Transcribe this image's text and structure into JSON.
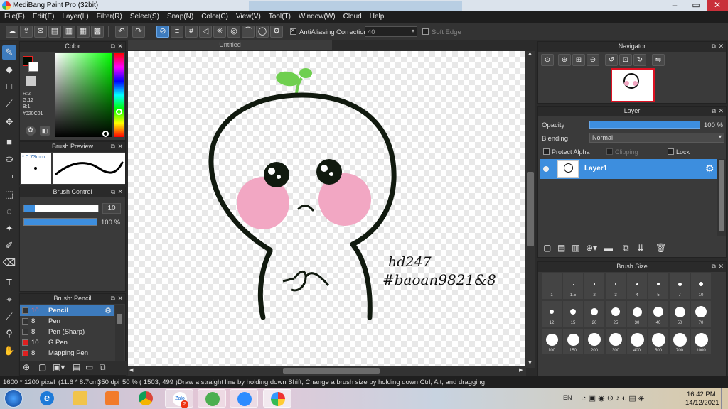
{
  "window": {
    "title": "MediBang Paint Pro (32bit)"
  },
  "menu": [
    "File(F)",
    "Edit(E)",
    "Layer(L)",
    "Filter(R)",
    "Select(S)",
    "Snap(N)",
    "Color(C)",
    "View(V)",
    "Tool(T)",
    "Window(W)",
    "Cloud",
    "Help"
  ],
  "toolbar": {
    "antialiasing_label": "AntiAliasing",
    "correction_label": "Correction",
    "correction_value": "40",
    "soft_edge_label": "Soft Edge",
    "icons": [
      "cloud-icon",
      "upload-icon",
      "chat-icon",
      "document-icon",
      "document-icon",
      "grid-icon",
      "grid-icon",
      "undo-icon",
      "redo-icon",
      "snap-off-icon",
      "parallel-snap-icon",
      "grid-snap-icon",
      "perspective-snap-icon",
      "radial-snap-icon",
      "circle-snap-icon",
      "curve-snap-icon",
      "ellipse-snap-icon",
      "settings-icon"
    ]
  },
  "color_panel": {
    "title": "Color",
    "fg_color": "#020C01",
    "bg_color": "#ffffff",
    "r_label": "R:2",
    "g_label": "G:12",
    "b_label": "B:1",
    "hex_label": "#020C01"
  },
  "brush_preview": {
    "title": "Brush Preview",
    "size_label": "* 0.73mm"
  },
  "brush_control": {
    "title": "Brush Control",
    "size": "10",
    "opacity": "100 %",
    "size_fraction": 0.14,
    "opacity_fraction": 1.0
  },
  "brush_list": {
    "title": "Brush: Pencil",
    "items": [
      {
        "num": "10",
        "name": "Pencil",
        "color": "#333333",
        "selected": true
      },
      {
        "num": "8",
        "name": "Pen",
        "color": "#333333",
        "selected": false
      },
      {
        "num": "8",
        "name": "Pen (Sharp)",
        "color": "#333333",
        "selected": false
      },
      {
        "num": "10",
        "name": "G Pen",
        "color": "#e02020",
        "selected": false
      },
      {
        "num": "8",
        "name": "Mapping Pen",
        "color": "#e02020",
        "selected": false
      }
    ]
  },
  "canvas": {
    "tab_title": "Untitled",
    "handwriting_line1": "hd247",
    "handwriting_line2": "#baoan9821&8",
    "colors": {
      "outline": "#111a0f",
      "blush": "#f2a7c3",
      "sprout": "#6fcf4f"
    }
  },
  "navigator": {
    "title": "Navigator",
    "icons": [
      "zoom-fit-icon",
      "zoom-in-icon",
      "zoom-window-icon",
      "zoom-out-icon",
      "rotate-left-icon",
      "reset-icon",
      "rotate-right-icon",
      "flip-icon"
    ]
  },
  "layer_panel": {
    "title": "Layer",
    "opacity_label": "Opacity",
    "opacity_value": "100 %",
    "blending_label": "Blending",
    "blending_value": "Normal",
    "protect_alpha": "Protect Alpha",
    "clipping": "Clipping",
    "lock": "Lock",
    "layers": [
      {
        "name": "Layer1",
        "selected": true
      }
    ]
  },
  "brush_size_panel": {
    "title": "Brush Size",
    "sizes": [
      "1",
      "1.5",
      "2",
      "3",
      "4",
      "5",
      "7",
      "10",
      "12",
      "15",
      "20",
      "25",
      "30",
      "40",
      "50",
      "70",
      "100",
      "150",
      "200",
      "300",
      "400",
      "500",
      "700",
      "1000"
    ]
  },
  "status": {
    "dimensions": "1600 * 1200 pixel",
    "physical": "(11.6 * 8.7cm)",
    "dpi": "350 dpi",
    "zoom": "50 %",
    "coords": "( 1503, 499 )",
    "hint": "Draw a straight line by holding down Shift, Change a brush size by holding down Ctrl, Alt, and dragging"
  },
  "taskbar": {
    "lang": "EN",
    "time": "16:42 PM",
    "date": "14/12/2021",
    "zalo_badge": "2",
    "zalo_label": "Zalo"
  }
}
